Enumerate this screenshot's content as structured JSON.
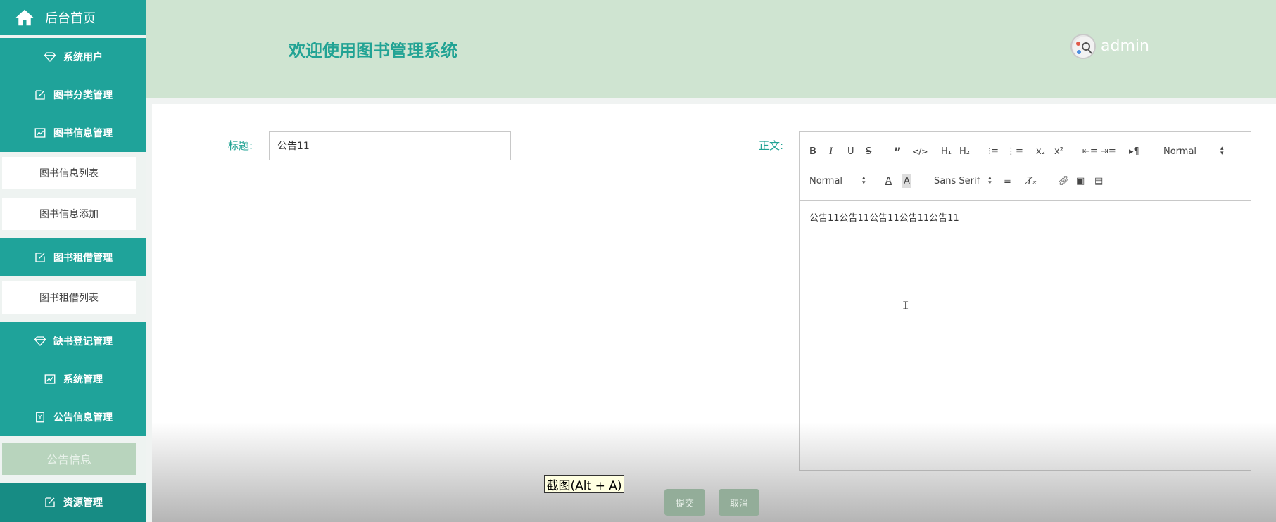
{
  "sidebar": {
    "home_label": "后台首页",
    "categories": [
      {
        "label": "系统用户",
        "icon": "diamond-icon"
      },
      {
        "label": "图书分类管理",
        "icon": "edit-icon"
      },
      {
        "label": "图书信息管理",
        "icon": "chart-icon"
      },
      {
        "label": "图书租借管理",
        "icon": "edit-icon"
      },
      {
        "label": "缺书登记管理",
        "icon": "diamond-icon"
      },
      {
        "label": "系统管理",
        "icon": "chart-icon"
      },
      {
        "label": "公告信息管理",
        "icon": "bookmark-icon"
      },
      {
        "label": "资源管理",
        "icon": "edit-icon"
      }
    ],
    "subitems": [
      {
        "label": "图书信息列表"
      },
      {
        "label": "图书信息添加"
      },
      {
        "label": "图书租借列表"
      },
      {
        "label": "公告信息"
      }
    ]
  },
  "header": {
    "title": "欢迎使用图书管理系统",
    "username": "admin"
  },
  "form": {
    "title_label": "标题:",
    "title_value": "公告11",
    "body_label": "正文:",
    "body_value": "公告11公告11公告11公告11公告11",
    "submit_label": "提交",
    "cancel_label": "取消"
  },
  "editor": {
    "header_select": "Normal",
    "size_select": "Normal",
    "font_select": "Sans Serif"
  },
  "tooltip": {
    "text": "截图(Alt + A)"
  },
  "colors": {
    "accent": "#1fa39a",
    "header_bg": "#cfe4d1",
    "title_text": "#22a394"
  }
}
